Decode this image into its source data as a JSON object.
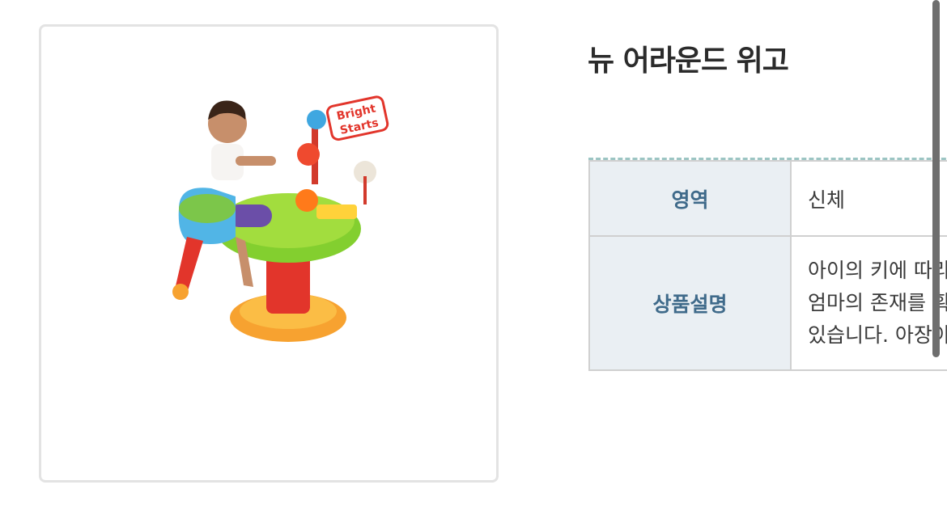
{
  "product": {
    "title": "뉴 어라운드 위고",
    "image": {
      "brand_logo_text": [
        "Bright",
        "Starts"
      ]
    }
  },
  "info_table": {
    "rows": [
      {
        "label": "영역",
        "value": "신체"
      },
      {
        "label": "상품설명",
        "lines": [
          "아이의 키에 따라",
          "엄마의 존재를 확",
          "있습니다. 아장아"
        ]
      }
    ]
  },
  "colors": {
    "header_bg": "#eaeff3",
    "header_text": "#3f6a8a",
    "dashed_border": "#9cc5c3",
    "title_text": "#2b2b2b"
  }
}
